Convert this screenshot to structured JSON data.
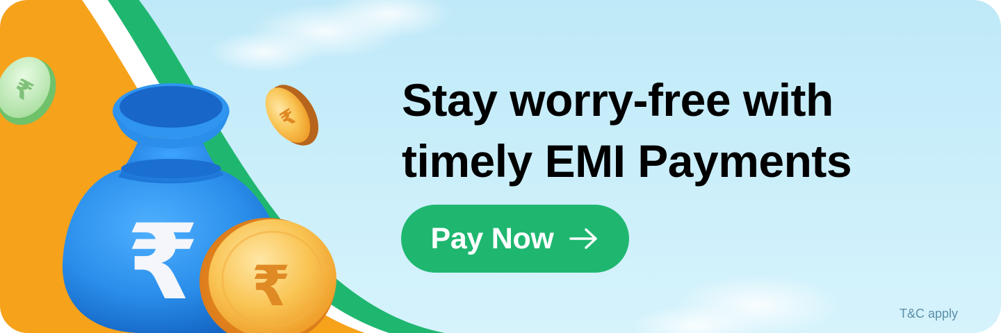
{
  "banner": {
    "headline_line1": "Stay worry-free with",
    "headline_line2": "timely EMI Payments",
    "cta_label": "Pay Now",
    "cta_icon": "arrow-right-icon",
    "terms": "T&C apply",
    "currency_symbol": "₹"
  },
  "colors": {
    "sky": "#c9eefa",
    "saffron": "#f7a21b",
    "green_band": "#1fb770",
    "button": "#1fb770",
    "bag_blue": "#2a8eea",
    "coin_gold": "#f6b035",
    "terms_text": "#5a8fa8"
  }
}
